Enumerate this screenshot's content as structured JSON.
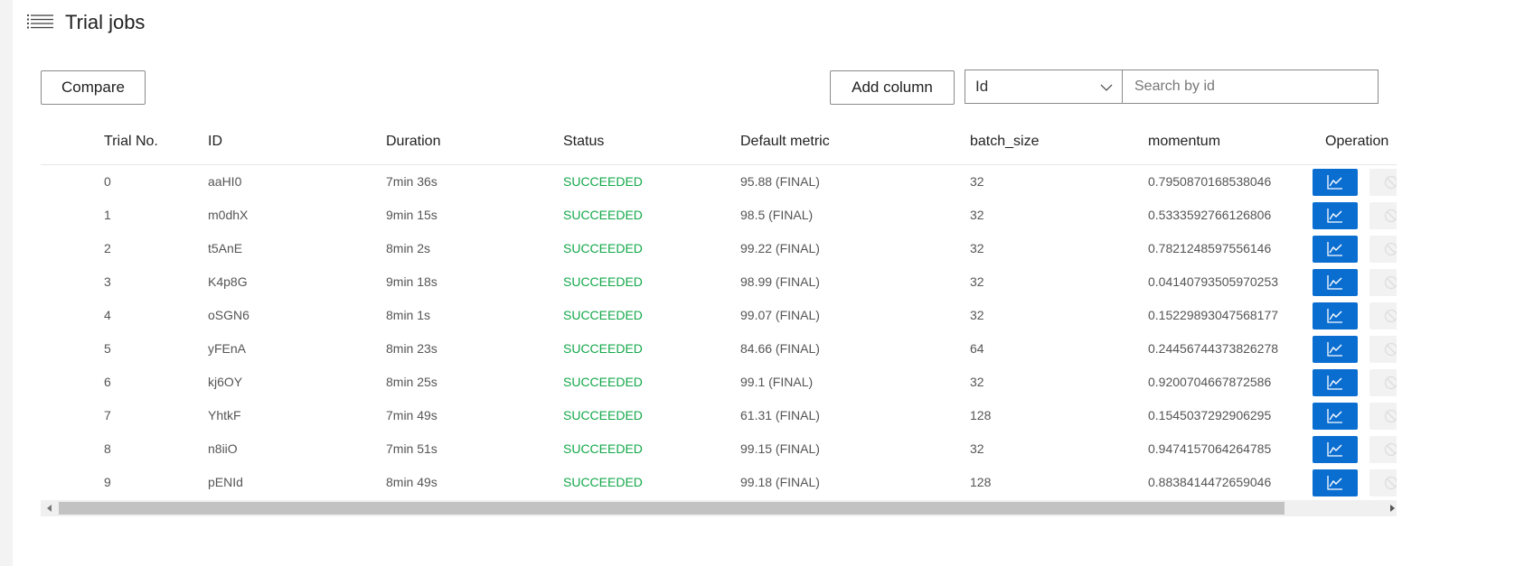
{
  "header": {
    "title": "Trial jobs",
    "icon": "list-icon"
  },
  "toolbar": {
    "compare_label": "Compare",
    "add_column_label": "Add column",
    "search_field": {
      "selected": "Id"
    },
    "search": {
      "placeholder": "Search by id",
      "value": ""
    }
  },
  "table": {
    "columns": [
      "Trial No.",
      "ID",
      "Duration",
      "Status",
      "Default metric",
      "batch_size",
      "momentum",
      "Operation"
    ],
    "rows": [
      {
        "trial_no": "0",
        "id": "aaHI0",
        "duration": "7min 36s",
        "status": "SUCCEEDED",
        "metric": "95.88 (FINAL)",
        "batch_size": "32",
        "momentum": "0.7950870168538046"
      },
      {
        "trial_no": "1",
        "id": "m0dhX",
        "duration": "9min 15s",
        "status": "SUCCEEDED",
        "metric": "98.5 (FINAL)",
        "batch_size": "32",
        "momentum": "0.5333592766126806"
      },
      {
        "trial_no": "2",
        "id": "t5AnE",
        "duration": "8min 2s",
        "status": "SUCCEEDED",
        "metric": "99.22 (FINAL)",
        "batch_size": "32",
        "momentum": "0.7821248597556146"
      },
      {
        "trial_no": "3",
        "id": "K4p8G",
        "duration": "9min 18s",
        "status": "SUCCEEDED",
        "metric": "98.99 (FINAL)",
        "batch_size": "32",
        "momentum": "0.04140793505970253"
      },
      {
        "trial_no": "4",
        "id": "oSGN6",
        "duration": "8min 1s",
        "status": "SUCCEEDED",
        "metric": "99.07 (FINAL)",
        "batch_size": "32",
        "momentum": "0.15229893047568177"
      },
      {
        "trial_no": "5",
        "id": "yFEnA",
        "duration": "8min 23s",
        "status": "SUCCEEDED",
        "metric": "84.66 (FINAL)",
        "batch_size": "64",
        "momentum": "0.24456744373826278"
      },
      {
        "trial_no": "6",
        "id": "kj6OY",
        "duration": "8min 25s",
        "status": "SUCCEEDED",
        "metric": "99.1 (FINAL)",
        "batch_size": "32",
        "momentum": "0.9200704667872586"
      },
      {
        "trial_no": "7",
        "id": "YhtkF",
        "duration": "7min 49s",
        "status": "SUCCEEDED",
        "metric": "61.31 (FINAL)",
        "batch_size": "128",
        "momentum": "0.1545037292906295"
      },
      {
        "trial_no": "8",
        "id": "n8iiO",
        "duration": "7min 51s",
        "status": "SUCCEEDED",
        "metric": "99.15 (FINAL)",
        "batch_size": "32",
        "momentum": "0.9474157064264785"
      },
      {
        "trial_no": "9",
        "id": "pENId",
        "duration": "8min 49s",
        "status": "SUCCEEDED",
        "metric": "99.18 (FINAL)",
        "batch_size": "128",
        "momentum": "0.8838414472659046"
      }
    ],
    "operation_icons": [
      "line-chart-icon",
      "block-icon"
    ]
  },
  "colors": {
    "primary": "#0a6ed1",
    "succeeded": "#13a84a"
  }
}
